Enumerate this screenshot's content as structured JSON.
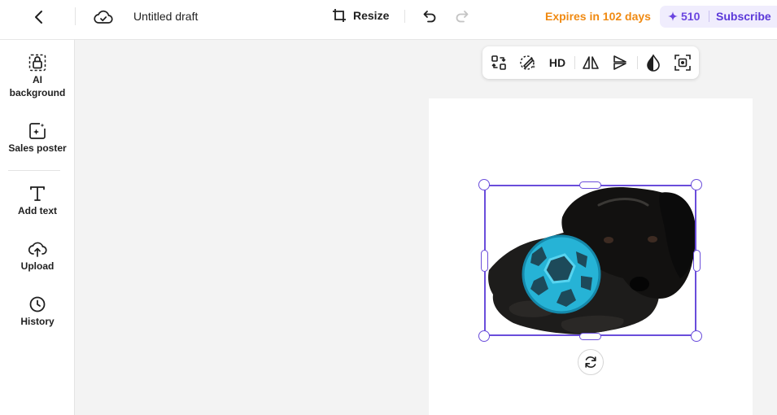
{
  "header": {
    "title": "Untitled draft",
    "resize_label": "Resize",
    "expires_label": "Expires in 102 days",
    "credits": "510",
    "subscribe_label": "Subscribe",
    "colors": {
      "expires": "#f08a12",
      "accent": "#6a45e0"
    }
  },
  "sidebar": {
    "items": [
      {
        "label": "AI background",
        "icon": "ai-background-icon"
      },
      {
        "label": "Sales poster",
        "icon": "sales-poster-icon"
      },
      {
        "label": "Add text",
        "icon": "text-icon"
      },
      {
        "label": "Upload",
        "icon": "upload-icon"
      },
      {
        "label": "History",
        "icon": "history-icon"
      }
    ]
  },
  "toolbar": {
    "hd_label": "HD",
    "tools": [
      "replace-icon",
      "remove-background-icon",
      "hd",
      "flip-horizontal-icon",
      "flip-vertical-icon",
      "opacity-icon",
      "crop-icon"
    ]
  },
  "canvas": {
    "selection_color": "#6a4ddb",
    "element_image": "black-dog-with-blue-ball"
  }
}
